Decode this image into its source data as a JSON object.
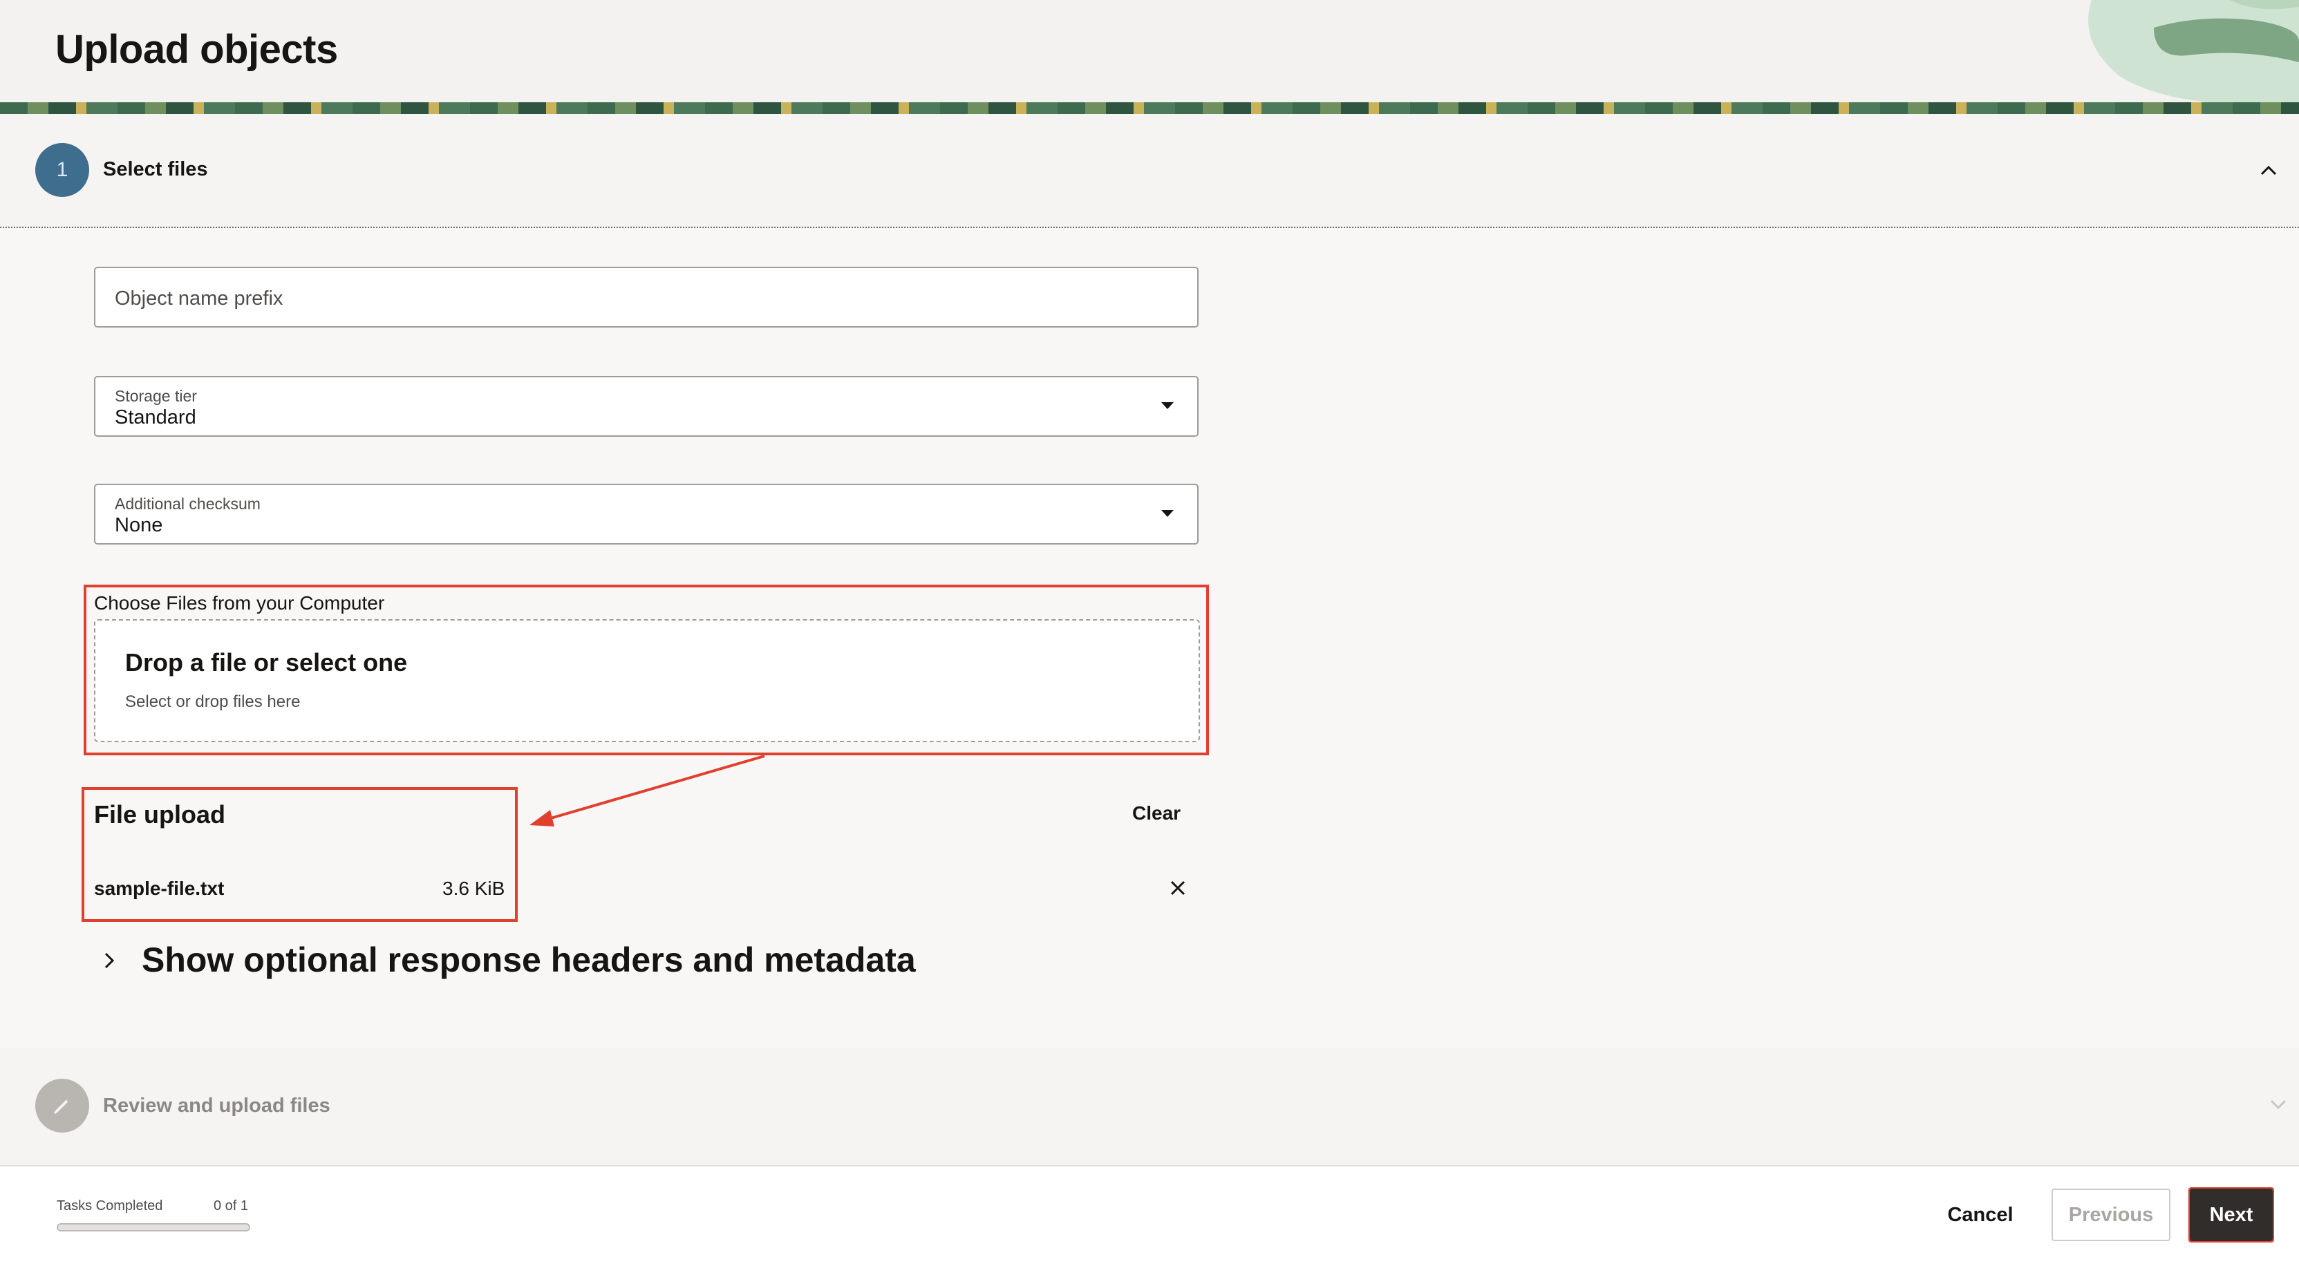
{
  "header": {
    "title": "Upload objects"
  },
  "steps": [
    {
      "number": "1",
      "label": "Select files"
    },
    {
      "label": "Review and upload files"
    }
  ],
  "form": {
    "prefix_placeholder": "Object name prefix",
    "storage_tier": {
      "label": "Storage tier",
      "value": "Standard"
    },
    "checksum": {
      "label": "Additional checksum",
      "value": "None"
    },
    "choose_label": "Choose Files from your Computer",
    "dropzone": {
      "title": "Drop a file or select one",
      "subtitle": "Select or drop files here"
    }
  },
  "upload": {
    "title": "File upload",
    "clear_label": "Clear",
    "files": [
      {
        "name": "sample-file.txt",
        "size": "3.6 KiB"
      }
    ]
  },
  "optional": {
    "label": "Show optional response headers and metadata"
  },
  "footer": {
    "tasks_label": "Tasks Completed",
    "tasks_count": "0 of 1",
    "progress": 0,
    "cancel_label": "Cancel",
    "previous_label": "Previous",
    "next_label": "Next"
  },
  "colors": {
    "accent": "#3e6d8e",
    "highlight": "#e0412e",
    "primary_button": "#312d2a"
  }
}
